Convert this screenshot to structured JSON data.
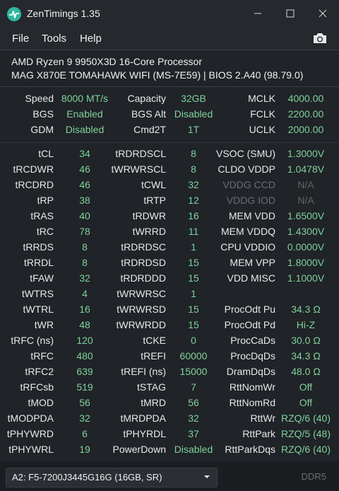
{
  "window": {
    "title": "ZenTimings 1.35"
  },
  "menu": {
    "file": "File",
    "tools": "Tools",
    "help": "Help"
  },
  "icons": {
    "app": "zentimings-app-icon",
    "minimize": "minimize-icon",
    "maximize": "maximize-icon",
    "close": "close-icon",
    "screenshot": "camera-icon",
    "dropdown": "chevron-down-icon"
  },
  "system": {
    "cpu": "AMD Ryzen 9 9950X3D 16-Core Processor",
    "board": "MAG X870E TOMAHAWK WIFI (MS-7E59) | BIOS 2.A40 (98.79.0)"
  },
  "summary": [
    [
      "Speed",
      "8000 MT/s",
      "Capacity",
      "32GB",
      "MCLK",
      "4000.00"
    ],
    [
      "BGS",
      "Enabled",
      "BGS Alt",
      "Disabled",
      "FCLK",
      "2200.00"
    ],
    [
      "GDM",
      "Disabled",
      "Cmd2T",
      "1T",
      "UCLK",
      "2000.00"
    ]
  ],
  "timings": [
    [
      "tCL",
      "34",
      "tRDRDSCL",
      "8",
      "VSOC (SMU)",
      "1.3000V"
    ],
    [
      "tRCDWR",
      "46",
      "tWRWRSCL",
      "8",
      "CLDO VDDP",
      "1.0478V"
    ],
    [
      "tRCDRD",
      "46",
      "tCWL",
      "32",
      "VDDG CCD",
      "N/A"
    ],
    [
      "tRP",
      "38",
      "tRTP",
      "12",
      "VDDG IOD",
      "N/A"
    ],
    [
      "tRAS",
      "40",
      "tRDWR",
      "16",
      "MEM VDD",
      "1.6500V"
    ],
    [
      "tRC",
      "78",
      "tWRRD",
      "11",
      "MEM VDDQ",
      "1.4300V"
    ],
    [
      "tRRDS",
      "8",
      "tRDRDSC",
      "1",
      "CPU VDDIO",
      "0.0000V"
    ],
    [
      "tRRDL",
      "8",
      "tRDRDSD",
      "15",
      "MEM VPP",
      "1.8000V"
    ],
    [
      "tFAW",
      "32",
      "tRDRDDD",
      "15",
      "VDD MISC",
      "1.1000V"
    ],
    [
      "tWTRS",
      "4",
      "tWRWRSC",
      "1",
      "",
      ""
    ],
    [
      "tWTRL",
      "16",
      "tWRWRSD",
      "15",
      "ProcOdt Pu",
      "34.3 Ω"
    ],
    [
      "tWR",
      "48",
      "tWRWRDD",
      "15",
      "ProcOdt Pd",
      "Hi-Z"
    ],
    [
      "tRFC (ns)",
      "120",
      "tCKE",
      "0",
      "ProcCaDs",
      "30.0 Ω"
    ],
    [
      "tRFC",
      "480",
      "tREFI",
      "60000",
      "ProcDqDs",
      "34.3 Ω"
    ],
    [
      "tRFC2",
      "639",
      "tREFI (ns)",
      "15000",
      "DramDqDs",
      "48.0 Ω"
    ],
    [
      "tRFCsb",
      "519",
      "tSTAG",
      "7",
      "RttNomWr",
      "Off"
    ],
    [
      "tMOD",
      "56",
      "tMRD",
      "56",
      "RttNomRd",
      "Off"
    ],
    [
      "tMODPDA",
      "32",
      "tMRDPDA",
      "32",
      "RttWr",
      "RZQ/6 (40)"
    ],
    [
      "tPHYWRD",
      "6",
      "tPHYRDL",
      "37",
      "RttPark",
      "RZQ/5 (48)"
    ],
    [
      "tPHYWRL",
      "19",
      "PowerDown",
      "Disabled",
      "RttParkDqs",
      "RZQ/6 (40)"
    ]
  ],
  "dimmed_rows": [
    2,
    3
  ],
  "footer": {
    "module": "A2: F5-7200J3445G16G (16GB, SR)",
    "memtype": "DDR5"
  },
  "colors": {
    "value": "#7fd29a",
    "background": "#202328"
  }
}
